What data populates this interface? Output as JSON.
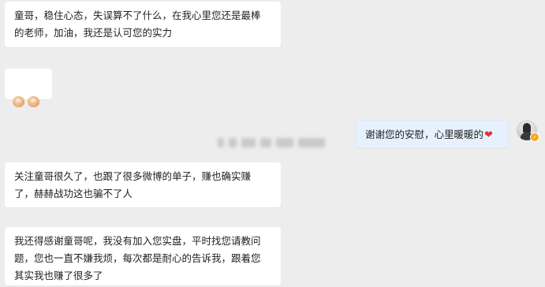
{
  "messages": [
    {
      "side": "left",
      "text": "童哥，稳住心态，失误算不了什么，在我心里您还是最棒\n的老师，加油，我还是认可您的实力"
    },
    {
      "side": "left",
      "emoji": [
        "clap",
        "clap"
      ]
    },
    {
      "side": "right",
      "text": "谢谢您的安慰，心里暖暖的",
      "heart": "❤"
    },
    {
      "side": "left",
      "text": "关注童哥很久了，也跟了很多微博的单子，赚也确实赚\n了，赫赫战功这也骗不了人"
    },
    {
      "side": "left",
      "text": "我还得感谢童哥呢，我没有加入您实盘，平时找您请教问\n题，您也一直不嫌我烦，每次都是耐心的告诉我，跟着您\n其实我也赚了很多了"
    }
  ],
  "avatar": {
    "badge": "✓"
  },
  "colors": {
    "background": "#ededed",
    "incoming_bubble": "#ffffff",
    "outgoing_bubble": "#e7f1fe",
    "heart": "#e0303e",
    "badge": "#f5a623"
  }
}
